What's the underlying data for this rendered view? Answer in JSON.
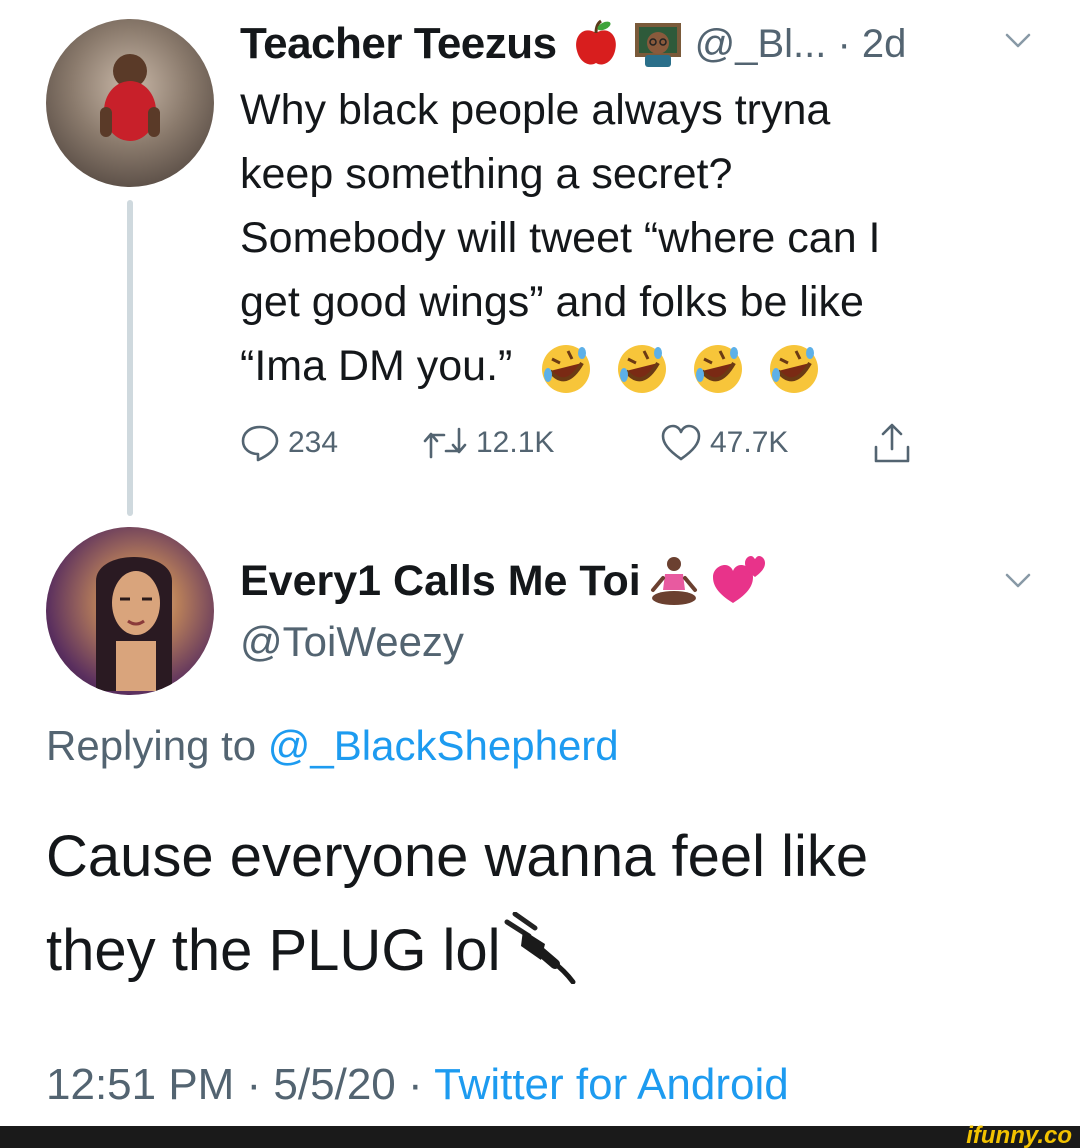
{
  "tweet1": {
    "name": "Teacher Teezus",
    "name_emojis": [
      "red-apple-emoji",
      "teacher-emoji"
    ],
    "handle_and_time": "@_Bl... · 2d",
    "body_lines": [
      "Why black people always tryna",
      "keep something a secret?",
      "Somebody will tweet “where can I",
      "get good wings” and folks be like",
      "“Ima DM you.”"
    ],
    "body_emojis": [
      "rolling-on-floor-laughing-emoji",
      "rolling-on-floor-laughing-emoji",
      "rolling-on-floor-laughing-emoji",
      "rolling-on-floor-laughing-emoji"
    ],
    "actions": {
      "replies": "234",
      "retweets": "12.1K",
      "likes": "47.7K"
    }
  },
  "tweet2": {
    "name": "Every1 Calls Me Toi",
    "name_emojis": [
      "person-in-lotus-position-emoji",
      "two-hearts-emoji"
    ],
    "handle": "@ToiWeezy",
    "replying_prefix": "Replying to",
    "replying_mention": "@_BlackShepherd",
    "body_lines": [
      "Cause everyone wanna feel like",
      "they the PLUG lol"
    ],
    "body_emoji": "electric-plug-emoji",
    "timestamp": "12:51 PM · 5/5/20 ·",
    "source": "Twitter for Android"
  },
  "watermark": "ifunny.co",
  "colors": {
    "text": "#14171a",
    "secondary": "#536471",
    "link": "#1d9bf0",
    "thread_line": "#cfd9de"
  }
}
